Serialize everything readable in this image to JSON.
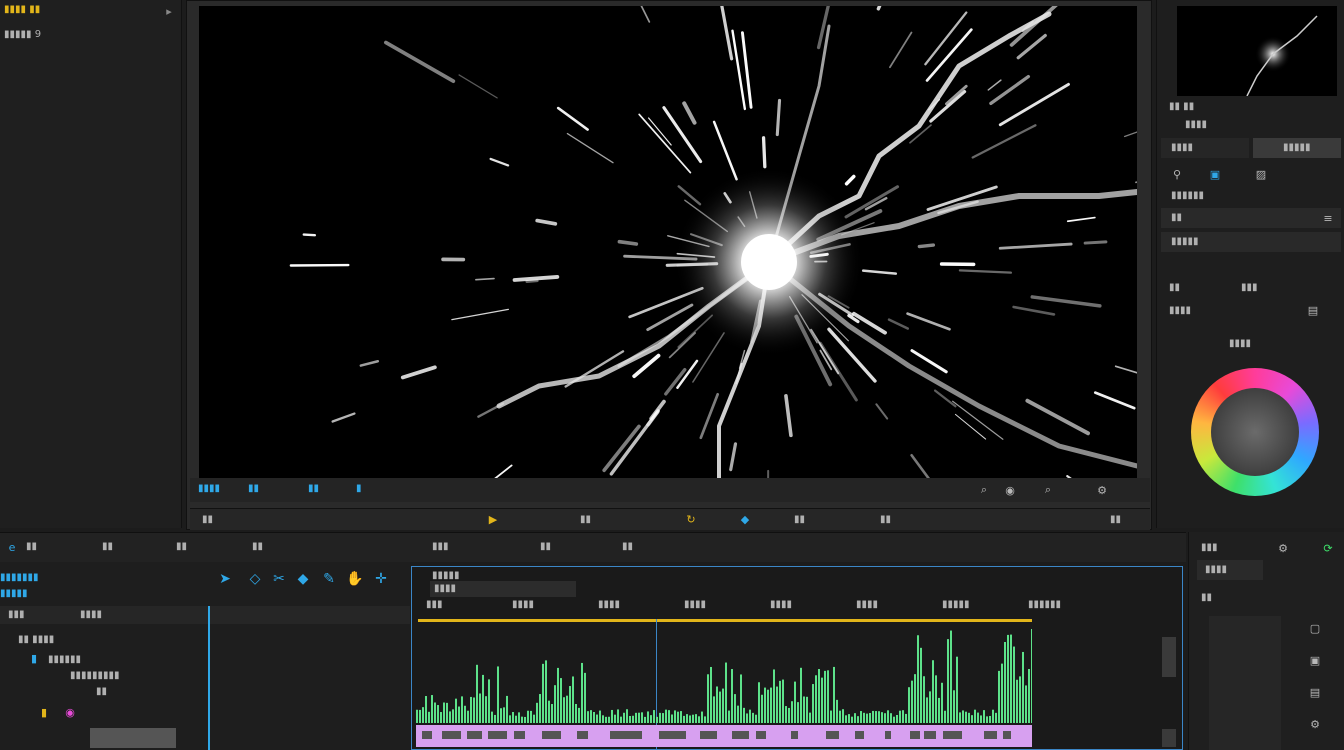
{
  "colors": {
    "accent_blue": "#2fa8e8",
    "accent_yellow": "#e2b51a",
    "waveform_green": "#5de28a",
    "clip_violet": "#d7a0f0",
    "timeline_border": "#3b86c7"
  },
  "left_panel": {
    "line1": "▮▮▮▮ ▮▮",
    "line2": "▮▮▮▮▮ 9",
    "icon_chevron": "chevron-icon"
  },
  "viewer": {
    "toolbar_label": "▮▮▮▮",
    "toolbar_items": [
      "▮▮",
      "▮▮",
      "▮"
    ],
    "ruler_marks": [
      "▮▮",
      "▮▮",
      "▮▮",
      "▮▮",
      "▮▮",
      "▮▮",
      "▮▮",
      "▮▮"
    ]
  },
  "right_panel": {
    "title": "▮▮ ▮▮",
    "subtitle": "▮▮▮▮",
    "tab_left": "▮▮▮▮",
    "tab_right": "▮▮▮▮▮",
    "section1": "▮▮▮▮▮▮",
    "field1": "▮▮",
    "field2": "▮▮▮▮▮",
    "section2": "▮▮",
    "section2_right": "▮▮▮",
    "field3": "▮▮▮▮",
    "wheel_label": "▮▮▮▮"
  },
  "timeline_header": {
    "tabs": [
      "▮▮",
      "▮▮",
      "▮▮",
      "▮▮",
      "▮▮▮",
      "▮▮",
      "▮▮"
    ]
  },
  "track_panel": {
    "row1": "▮▮▮▮▮▮▮",
    "row2": "▮▮▮▮▮",
    "row3": "▮▮▮",
    "row4": "▮▮▮▮",
    "row5": "▮▮ ▮▮▮▮",
    "row6": "▮▮▮▮▮▮",
    "row7": "▮▮▮▮▮▮▮▮▮",
    "row8": "▮▮"
  },
  "timeline": {
    "top_label": "▮▮▮▮▮",
    "track_label": "▮▮▮▮",
    "ticks": [
      "▮▮▮",
      "▮▮▮▮",
      "▮▮▮▮",
      "▮▮▮▮",
      "▮▮▮▮",
      "▮▮▮▮",
      "▮▮▮▮▮",
      "▮▮▮▮▮▮"
    ]
  },
  "side_tools": {
    "title": "▮▮▮",
    "button": "▮▮▮▮",
    "label": "▮▮"
  }
}
